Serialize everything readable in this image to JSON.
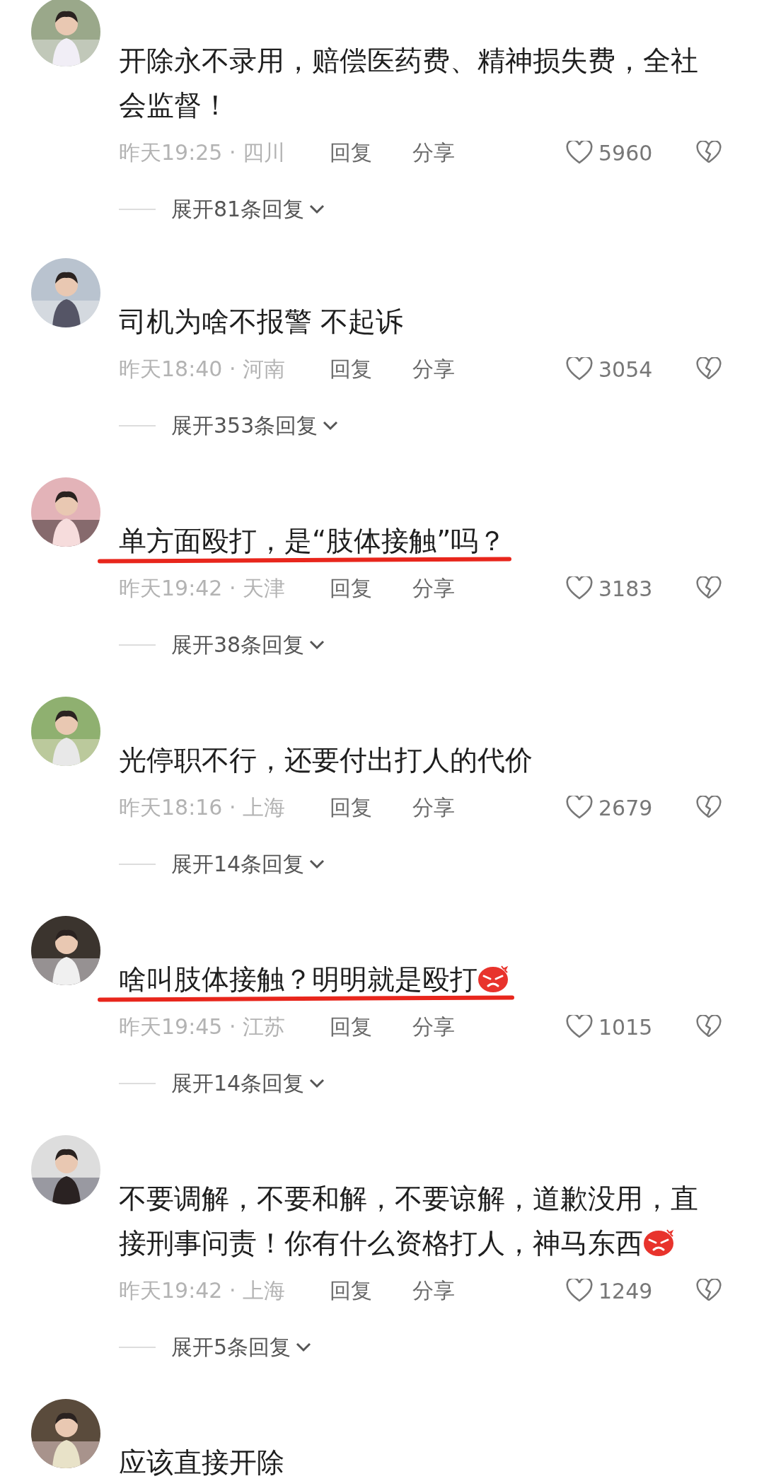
{
  "comments": [
    {
      "text": "开除永不录用，赔偿医药费、精神损失费，全社会监督！",
      "underlined": false,
      "time": "昨天19:25 · 四川",
      "reply": "回复",
      "share": "分享",
      "likes": "5960",
      "expand": "展开81条回复"
    },
    {
      "text": "司机为啥不报警 不起诉",
      "underlined": false,
      "time": "昨天18:40 · 河南",
      "reply": "回复",
      "share": "分享",
      "likes": "3054",
      "expand": "展开353条回复"
    },
    {
      "text": "单方面殴打，是“肢体接触”吗？",
      "underlined": true,
      "time": "昨天19:42 · 天津",
      "reply": "回复",
      "share": "分享",
      "likes": "3183",
      "expand": "展开38条回复"
    },
    {
      "text": "光停职不行，还要付出打人的代价",
      "underlined": false,
      "time": "昨天18:16 · 上海",
      "reply": "回复",
      "share": "分享",
      "likes": "2679",
      "expand": "展开14条回复"
    },
    {
      "text": "啥叫肢体接触？明明就是殴打",
      "emoji": {
        "kind": "angry"
      },
      "underlined": true,
      "time": "昨天19:45 · 江苏",
      "reply": "回复",
      "share": "分享",
      "likes": "1015",
      "expand": "展开14条回复"
    },
    {
      "text": "不要调解，不要和解，不要谅解，道歉没用，直接刑事问责！你有什么资格打人，神马东西",
      "emoji": {
        "kind": "angry"
      },
      "underlined": false,
      "time": "昨天19:42 · 上海",
      "reply": "回复",
      "share": "分享",
      "likes": "1249",
      "expand": "展开5条回复"
    },
    {
      "text": "应该直接开除",
      "underlined": false
    }
  ]
}
